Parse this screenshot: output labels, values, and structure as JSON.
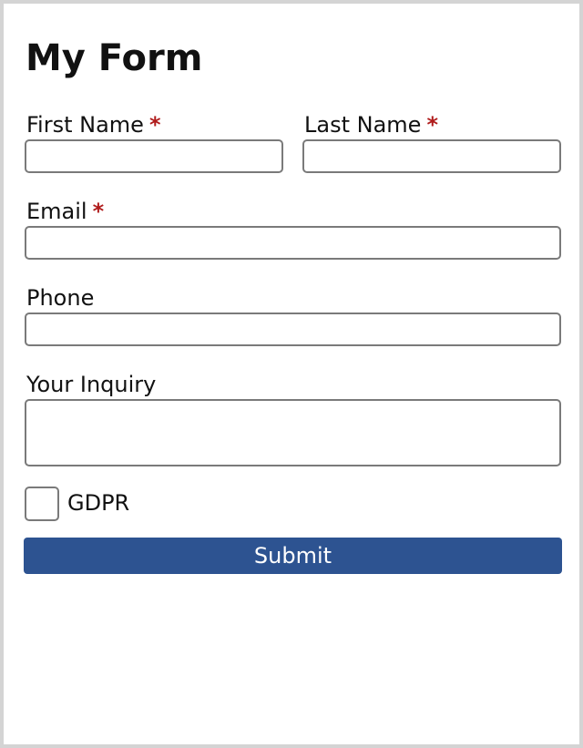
{
  "form": {
    "title": "My Form",
    "required_marker": "*",
    "fields": {
      "first_name": {
        "label": "First Name",
        "value": ""
      },
      "last_name": {
        "label": "Last Name",
        "value": ""
      },
      "email": {
        "label": "Email",
        "value": ""
      },
      "phone": {
        "label": "Phone",
        "value": ""
      },
      "inquiry": {
        "label": "Your Inquiry",
        "value": ""
      }
    },
    "gdpr": {
      "label": "GDPR",
      "checked": false
    },
    "submit_label": "Submit"
  },
  "colors": {
    "required": "#b01c1c",
    "submit_background": "#2d5391",
    "field_border": "#7a7a7a",
    "frame_border": "#d4d4d4"
  }
}
